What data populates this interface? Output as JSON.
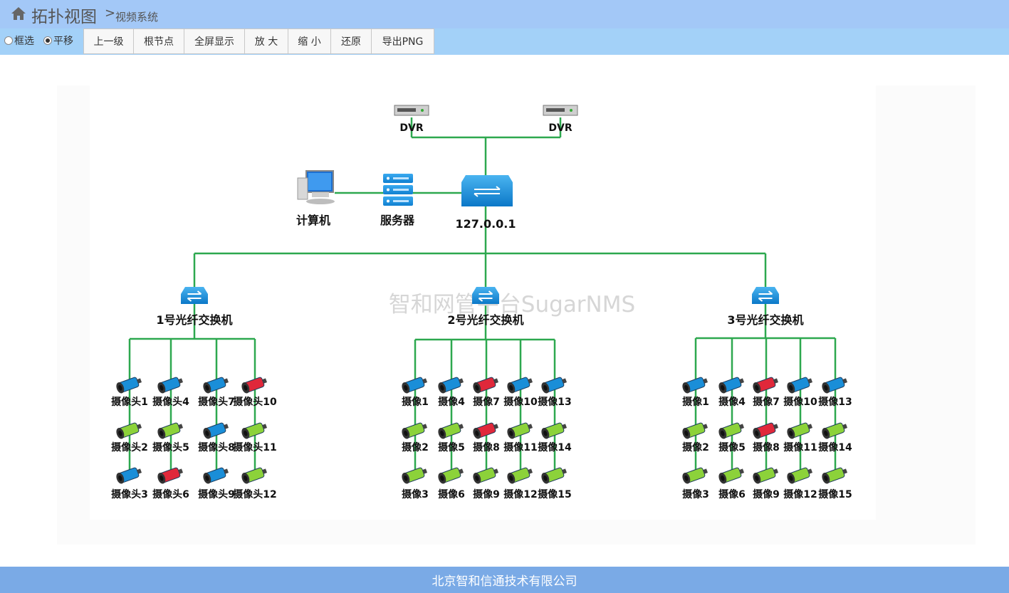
{
  "header": {
    "title": "拓扑视图",
    "separator": ">",
    "subtitle": "视频系统"
  },
  "toolbar": {
    "radios": [
      {
        "label": "框选",
        "checked": false
      },
      {
        "label": "平移",
        "checked": true
      }
    ],
    "buttons": [
      "上一级",
      "根节点",
      "全屏显示",
      "放 大",
      "缩 小",
      "还原",
      "导出PNG"
    ]
  },
  "topology": {
    "watermark": "智和网管平台SugarNMS",
    "dvrs": [
      "DVR",
      "DVR"
    ],
    "computer": "计算机",
    "server": "服务器",
    "core_switch": "127.0.0.1",
    "switches": [
      {
        "label": "1号光纤交换机",
        "cameras": [
          {
            "label": "摄像头1",
            "status": "blue"
          },
          {
            "label": "摄像头2",
            "status": "green"
          },
          {
            "label": "摄像头3",
            "status": "blue"
          },
          {
            "label": "摄像头4",
            "status": "blue"
          },
          {
            "label": "摄像头5",
            "status": "green"
          },
          {
            "label": "摄像头6",
            "status": "red"
          },
          {
            "label": "摄像头7",
            "status": "blue"
          },
          {
            "label": "摄像头8",
            "status": "blue"
          },
          {
            "label": "摄像头9",
            "status": "blue"
          },
          {
            "label": "摄像头10",
            "status": "red"
          },
          {
            "label": "摄像头11",
            "status": "green"
          },
          {
            "label": "摄像头12",
            "status": "green"
          }
        ]
      },
      {
        "label": "2号光纤交换机",
        "cameras": [
          {
            "label": "摄像1",
            "status": "blue"
          },
          {
            "label": "摄像2",
            "status": "green"
          },
          {
            "label": "摄像3",
            "status": "green"
          },
          {
            "label": "摄像4",
            "status": "blue"
          },
          {
            "label": "摄像5",
            "status": "green"
          },
          {
            "label": "摄像6",
            "status": "green"
          },
          {
            "label": "摄像7",
            "status": "red"
          },
          {
            "label": "摄像8",
            "status": "red"
          },
          {
            "label": "摄像9",
            "status": "green"
          },
          {
            "label": "摄像10",
            "status": "blue"
          },
          {
            "label": "摄像11",
            "status": "green"
          },
          {
            "label": "摄像12",
            "status": "green"
          },
          {
            "label": "摄像13",
            "status": "blue"
          },
          {
            "label": "摄像14",
            "status": "green"
          },
          {
            "label": "摄像15",
            "status": "green"
          }
        ]
      },
      {
        "label": "3号光纤交换机",
        "cameras": [
          {
            "label": "摄像1",
            "status": "blue"
          },
          {
            "label": "摄像2",
            "status": "green"
          },
          {
            "label": "摄像3",
            "status": "green"
          },
          {
            "label": "摄像4",
            "status": "blue"
          },
          {
            "label": "摄像5",
            "status": "green"
          },
          {
            "label": "摄像6",
            "status": "green"
          },
          {
            "label": "摄像7",
            "status": "red"
          },
          {
            "label": "摄像8",
            "status": "red"
          },
          {
            "label": "摄像9",
            "status": "green"
          },
          {
            "label": "摄像10",
            "status": "blue"
          },
          {
            "label": "摄像11",
            "status": "green"
          },
          {
            "label": "摄像12",
            "status": "green"
          },
          {
            "label": "摄像13",
            "status": "blue"
          },
          {
            "label": "摄像14",
            "status": "green"
          },
          {
            "label": "摄像15",
            "status": "green"
          }
        ]
      }
    ]
  },
  "colors": {
    "link": "#2da84f",
    "blue": "#1a8ed8",
    "green": "#8cd23a",
    "red": "#e0283a",
    "title_bar": "#a3c8f7",
    "toolbar": "#a3d1f8",
    "footer": "#7aaae6"
  },
  "footer": {
    "text": "北京智和信通技术有限公司"
  }
}
